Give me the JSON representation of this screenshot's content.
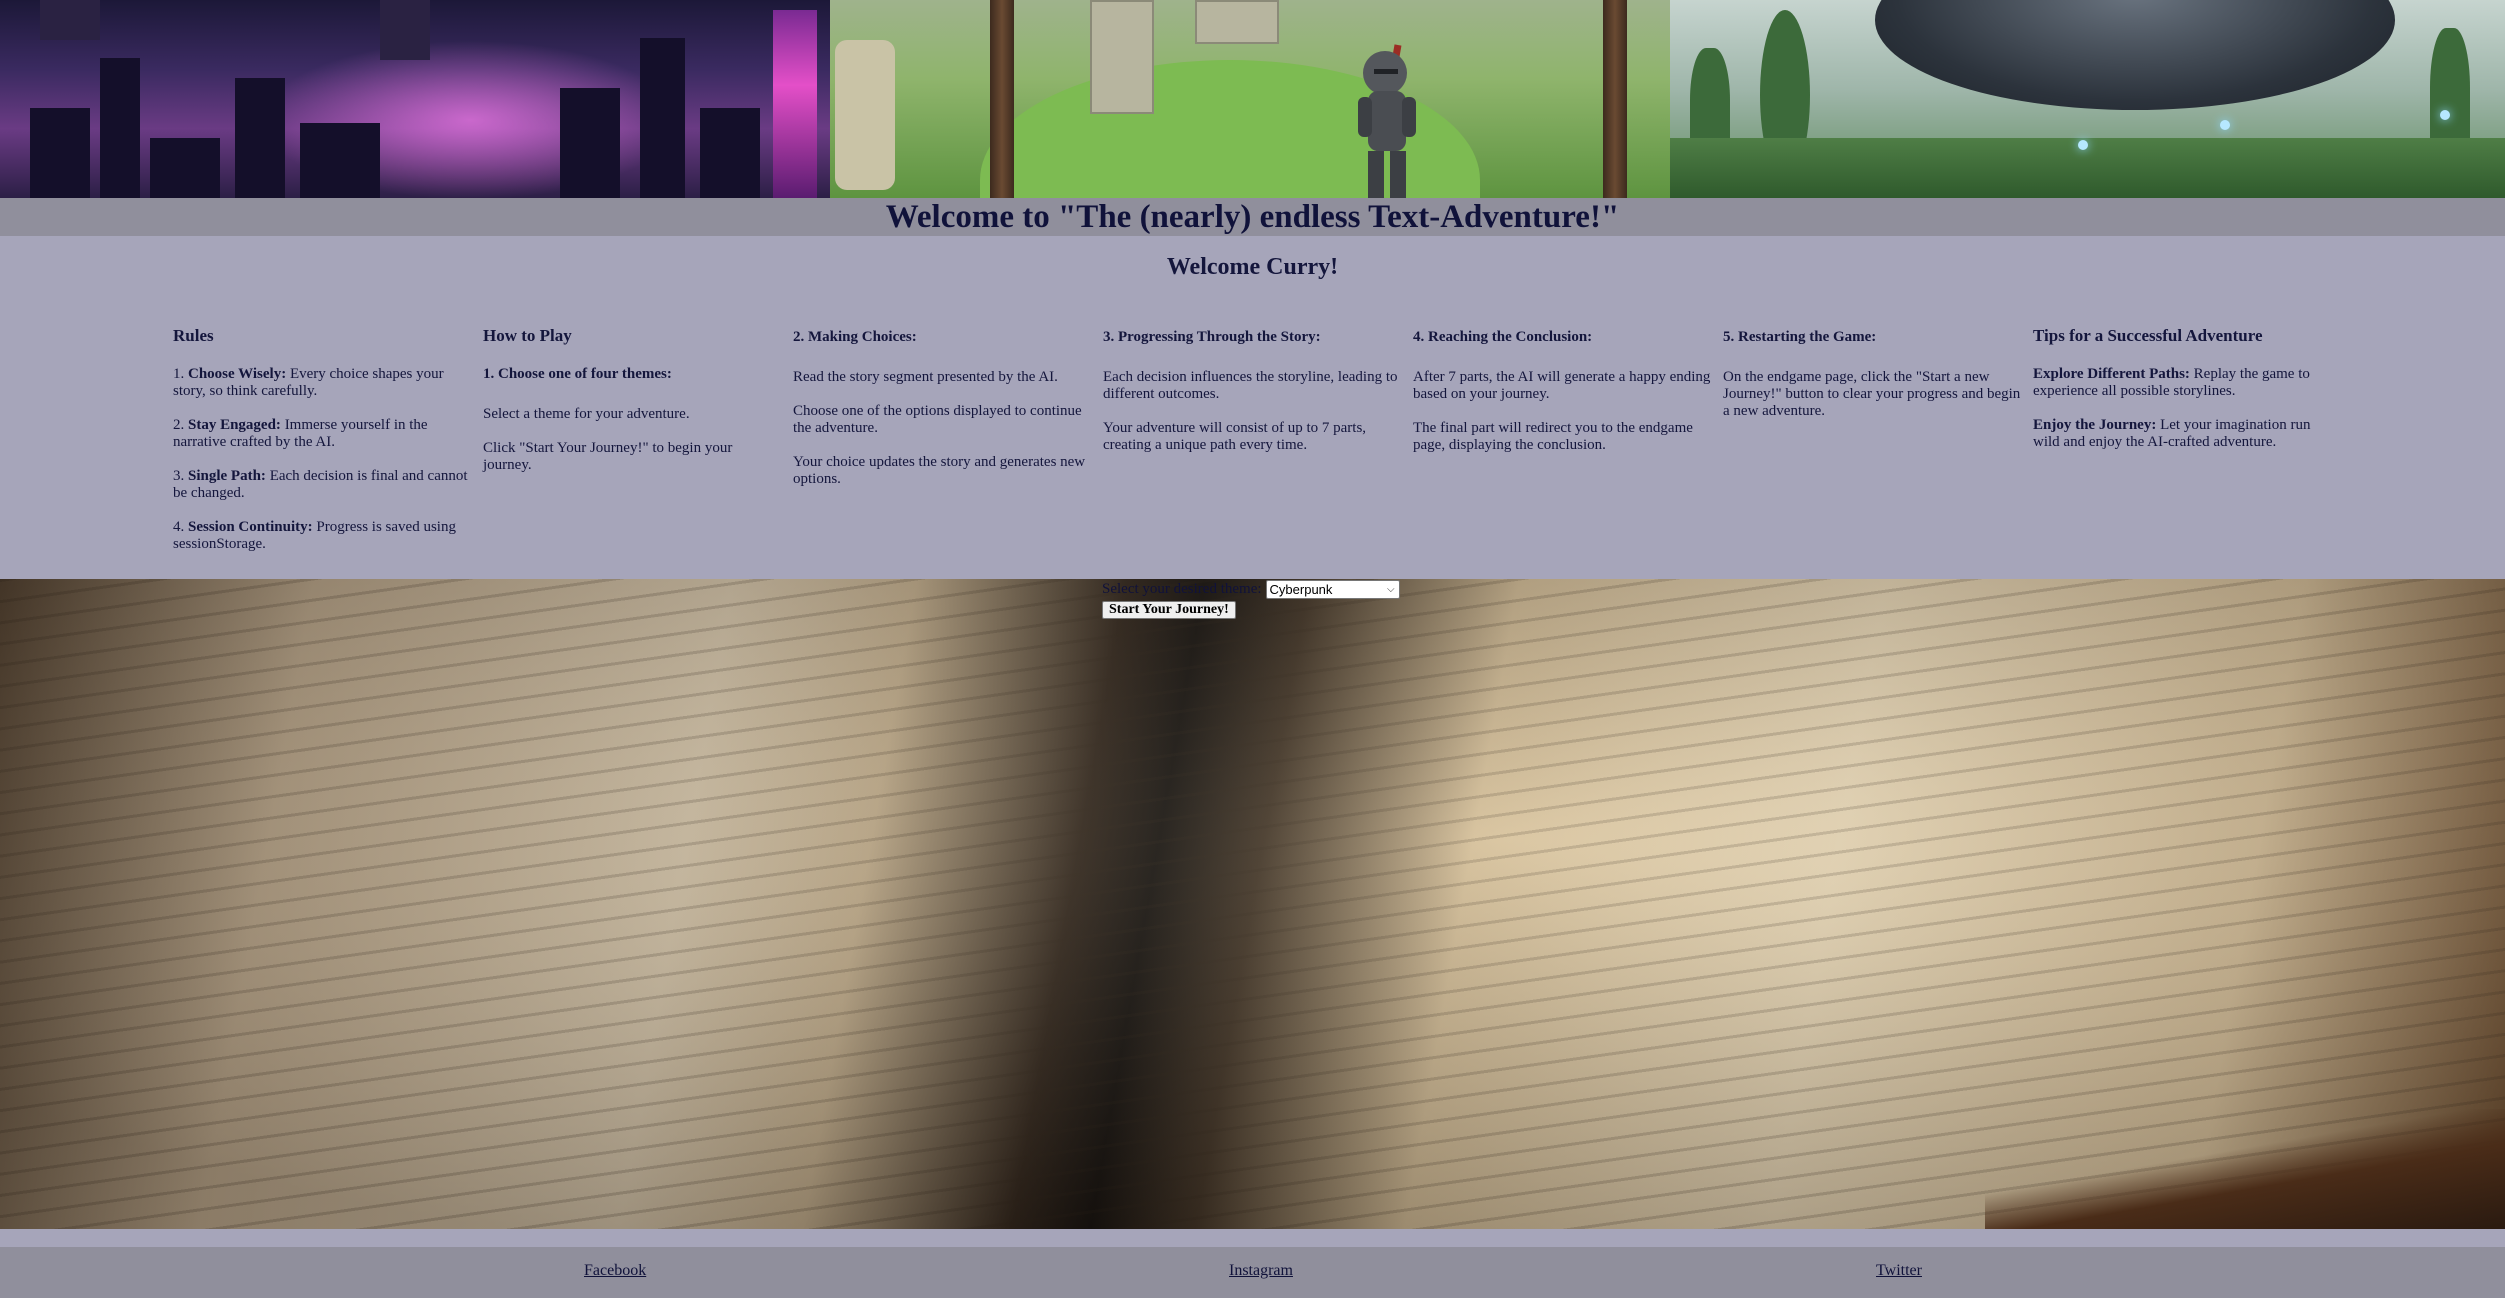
{
  "page": {
    "title": "Welcome to \"The (nearly) endless Text-Adventure!\"",
    "welcome": "Welcome Curry!"
  },
  "banner": {
    "panels": [
      "cyberpunk-city",
      "fantasy-knight",
      "scifi-spaceship"
    ]
  },
  "rules": {
    "heading": "Rules",
    "items": [
      {
        "num": "1.",
        "bold": "Choose Wisely:",
        "text": "Every choice shapes your story, so think carefully."
      },
      {
        "num": "2.",
        "bold": "Stay Engaged:",
        "text": "Immerse yourself in the narrative crafted by the AI."
      },
      {
        "num": "3.",
        "bold": "Single Path:",
        "text": "Each decision is final and cannot be changed."
      },
      {
        "num": "4.",
        "bold": "Session Continuity:",
        "text": "Progress is saved using sessionStorage."
      }
    ]
  },
  "how_to_play": {
    "heading": "How to Play",
    "subheading": "1. Choose one of four themes:",
    "paragraphs": [
      "Select a theme for your adventure.",
      "Click \"Start Your Journey!\" to begin your journey."
    ]
  },
  "making_choices": {
    "heading": "2. Making Choices:",
    "paragraphs": [
      "Read the story segment presented by the AI.",
      "Choose one of the options displayed to continue the adventure.",
      "Your choice updates the story and generates new options."
    ]
  },
  "progressing": {
    "heading": "3. Progressing Through the Story:",
    "paragraphs": [
      "Each decision influences the storyline, leading to different outcomes.",
      "Your adventure will consist of up to 7 parts, creating a unique path every time."
    ]
  },
  "conclusion": {
    "heading": "4. Reaching the Conclusion:",
    "paragraphs": [
      "After 7 parts, the AI will generate a happy ending based on your journey.",
      "The final part will redirect you to the endgame page, displaying the conclusion."
    ]
  },
  "restarting": {
    "heading": "5. Restarting the Game:",
    "paragraphs": [
      "On the endgame page, click the \"Start a new Journey!\" button to clear your progress and begin a new adventure."
    ]
  },
  "tips": {
    "heading": "Tips for a Successful Adventure",
    "items": [
      {
        "bold": "Explore Different Paths:",
        "text": "Replay the game to experience all possible storylines."
      },
      {
        "bold": "Enjoy the Journey:",
        "text": "Let your imagination run wild and enjoy the AI-crafted adventure."
      }
    ]
  },
  "theme_form": {
    "label": "Select your desired theme:",
    "selected": "Cyberpunk",
    "button": "Start Your Journey!"
  },
  "footer": {
    "links": [
      "Facebook",
      "Instagram",
      "Twitter"
    ]
  }
}
